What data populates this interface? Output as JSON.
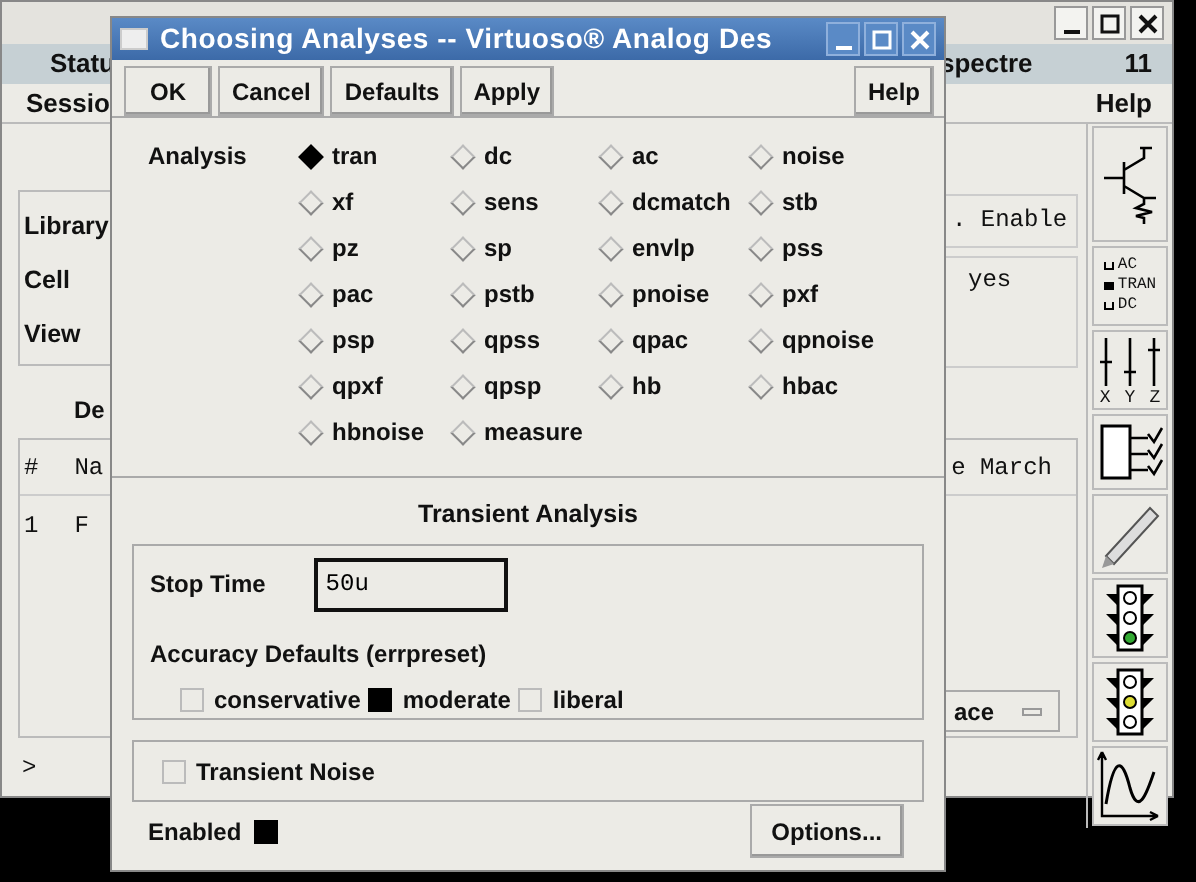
{
  "background_window": {
    "status_bar": {
      "left": "Statu",
      "simulator": "spectre",
      "number": "11"
    },
    "menu": [
      "Sessio",
      "Help"
    ],
    "design_labels": [
      "Library",
      "Cell",
      "View"
    ],
    "enable_field": ". Enable",
    "yes_field": "yes",
    "section_label": "De",
    "table": {
      "columns": [
        "#",
        "Na",
        "e March"
      ],
      "rows": [
        [
          "1",
          "F"
        ]
      ]
    },
    "dropdown": "ace",
    "prompt": ">",
    "toolbar_modes": [
      {
        "label": "AC",
        "selected": false
      },
      {
        "label": "TRAN",
        "selected": true
      },
      {
        "label": "DC",
        "selected": false
      }
    ],
    "toolbar_axes": [
      "X",
      "Y",
      "Z"
    ]
  },
  "dialog": {
    "title": "Choosing Analyses -- Virtuoso® Analog Des",
    "buttons": [
      "OK",
      "Cancel",
      "Defaults",
      "Apply"
    ],
    "help": "Help",
    "analysis_label": "Analysis",
    "analyses": [
      {
        "label": "tran",
        "selected": true
      },
      {
        "label": "dc",
        "selected": false
      },
      {
        "label": "ac",
        "selected": false
      },
      {
        "label": "noise",
        "selected": false
      },
      {
        "label": "xf",
        "selected": false
      },
      {
        "label": "sens",
        "selected": false
      },
      {
        "label": "dcmatch",
        "selected": false
      },
      {
        "label": "stb",
        "selected": false
      },
      {
        "label": "pz",
        "selected": false
      },
      {
        "label": "sp",
        "selected": false
      },
      {
        "label": "envlp",
        "selected": false
      },
      {
        "label": "pss",
        "selected": false
      },
      {
        "label": "pac",
        "selected": false
      },
      {
        "label": "pstb",
        "selected": false
      },
      {
        "label": "pnoise",
        "selected": false
      },
      {
        "label": "pxf",
        "selected": false
      },
      {
        "label": "psp",
        "selected": false
      },
      {
        "label": "qpss",
        "selected": false
      },
      {
        "label": "qpac",
        "selected": false
      },
      {
        "label": "qpnoise",
        "selected": false
      },
      {
        "label": "qpxf",
        "selected": false
      },
      {
        "label": "qpsp",
        "selected": false
      },
      {
        "label": "hb",
        "selected": false
      },
      {
        "label": "hbac",
        "selected": false
      },
      {
        "label": "hbnoise",
        "selected": false
      },
      {
        "label": "measure",
        "selected": false
      }
    ],
    "section_title": "Transient Analysis",
    "stop_time": {
      "label": "Stop Time",
      "value": "50u"
    },
    "accuracy": {
      "label": "Accuracy Defaults (errpreset)",
      "options": [
        {
          "label": "conservative",
          "selected": false
        },
        {
          "label": "moderate",
          "selected": true
        },
        {
          "label": "liberal",
          "selected": false
        }
      ]
    },
    "transient_noise": {
      "label": "Transient Noise",
      "checked": false
    },
    "enabled": {
      "label": "Enabled",
      "checked": true
    },
    "options_button": "Options..."
  }
}
